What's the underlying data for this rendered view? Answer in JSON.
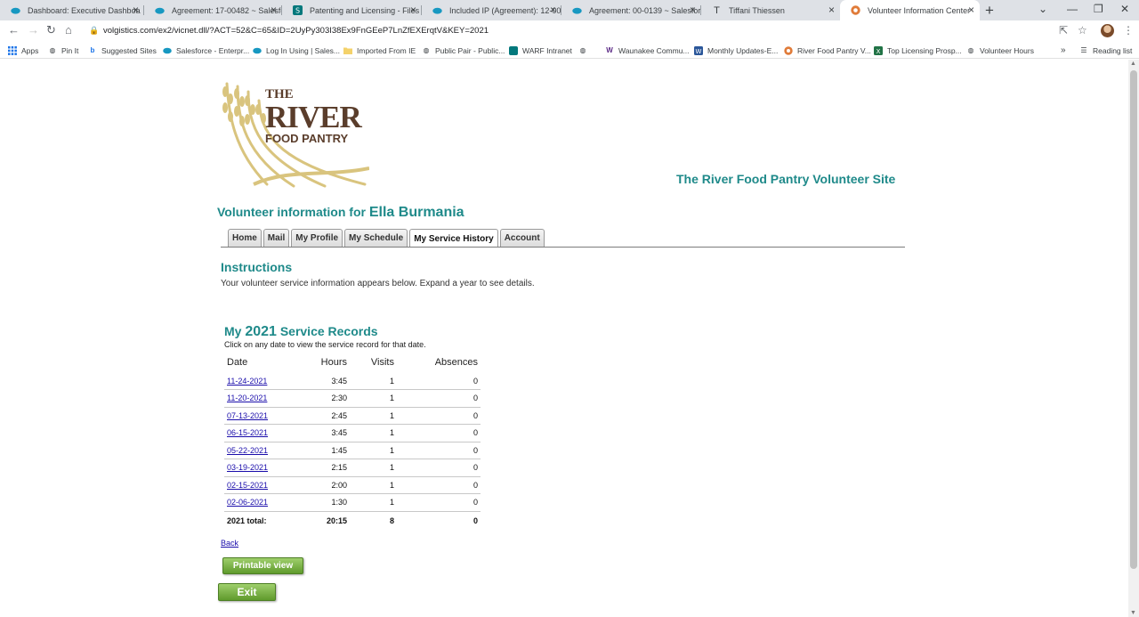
{
  "browser": {
    "tabs": [
      {
        "title": "Dashboard: Executive Dashboa",
        "icon": "salesforce-icon"
      },
      {
        "title": "Agreement: 17-00482 ~ Salesfo",
        "icon": "salesforce-icon"
      },
      {
        "title": "Patenting and Licensing - Files",
        "icon": "sharepoint-icon"
      },
      {
        "title": "Included IP (Agreement): 12-00",
        "icon": "salesforce-icon"
      },
      {
        "title": "Agreement: 00-0139 ~ Salesfor",
        "icon": "salesforce-icon"
      },
      {
        "title": "Tiffani Thiessen",
        "icon": "text-icon"
      },
      {
        "title": "Volunteer Information Center",
        "icon": "food-pantry-icon",
        "active": true
      }
    ],
    "url": "volgistics.com/ex2/vicnet.dll/?ACT=52&C=65&ID=2UyPy303I38Ex9FnGEeP7LnZfEXErqtV&KEY=2021",
    "bookmarks": [
      {
        "label": "Apps",
        "icon": "apps-grid-icon"
      },
      {
        "label": "Pin It",
        "icon": "globe-icon"
      },
      {
        "label": "Suggested Sites",
        "icon": "bing-icon"
      },
      {
        "label": "Salesforce - Enterpr...",
        "icon": "salesforce-icon"
      },
      {
        "label": "Log In Using | Sales...",
        "icon": "salesforce-icon"
      },
      {
        "label": "Imported From IE",
        "icon": "folder-icon"
      },
      {
        "label": "Public Pair - Public...",
        "icon": "globe-icon"
      },
      {
        "label": "WARF Intranet",
        "icon": "sharepoint-icon"
      },
      {
        "label": "",
        "icon": "globe-icon"
      },
      {
        "label": "Waunakee Commu...",
        "icon": "w-logo-icon"
      },
      {
        "label": "Monthly Updates-E...",
        "icon": "word-icon"
      },
      {
        "label": "River Food Pantry V...",
        "icon": "food-pantry-icon"
      },
      {
        "label": "Top Licensing Prosp...",
        "icon": "excel-icon"
      },
      {
        "label": "Volunteer Hours",
        "icon": "globe-icon"
      }
    ],
    "reading_list": "Reading list"
  },
  "page": {
    "logo": {
      "line1": "THE",
      "line2": "RIVER",
      "line3": "FOOD PANTRY"
    },
    "site_title": "The River Food Pantry Volunteer Site",
    "heading_prefix": "Volunteer information for",
    "volunteer_name": "Ella Burmania",
    "tabs": [
      {
        "label": "Home"
      },
      {
        "label": "Mail"
      },
      {
        "label": "My Profile"
      },
      {
        "label": "My Schedule"
      },
      {
        "label": "My Service History",
        "active": true
      },
      {
        "label": "Account"
      }
    ],
    "instructions_title": "Instructions",
    "instructions_text": "Your volunteer service information appears below. Expand a year to see details.",
    "records_title_prefix": "My",
    "records_year": "2021",
    "records_title_suffix": "Service Records",
    "records_subtitle": "Click on any date to view the service record for that date.",
    "columns": {
      "date": "Date",
      "hours": "Hours",
      "visits": "Visits",
      "absences": "Absences"
    },
    "rows": [
      {
        "date": "11-24-2021",
        "hours": "3:45",
        "visits": "1",
        "absences": "0"
      },
      {
        "date": "11-20-2021",
        "hours": "2:30",
        "visits": "1",
        "absences": "0"
      },
      {
        "date": "07-13-2021",
        "hours": "2:45",
        "visits": "1",
        "absences": "0"
      },
      {
        "date": "06-15-2021",
        "hours": "3:45",
        "visits": "1",
        "absences": "0"
      },
      {
        "date": "05-22-2021",
        "hours": "1:45",
        "visits": "1",
        "absences": "0"
      },
      {
        "date": "03-19-2021",
        "hours": "2:15",
        "visits": "1",
        "absences": "0"
      },
      {
        "date": "02-15-2021",
        "hours": "2:00",
        "visits": "1",
        "absences": "0"
      },
      {
        "date": "02-06-2021",
        "hours": "1:30",
        "visits": "1",
        "absences": "0"
      }
    ],
    "total": {
      "label": "2021 total:",
      "hours": "20:15",
      "visits": "8",
      "absences": "0"
    },
    "back_label": "Back",
    "printable_label": "Printable view",
    "exit_label": "Exit"
  },
  "colors": {
    "accent_teal": "#1f8a8a",
    "button_green": "#6aa533",
    "link_blue": "#1a0dab"
  }
}
